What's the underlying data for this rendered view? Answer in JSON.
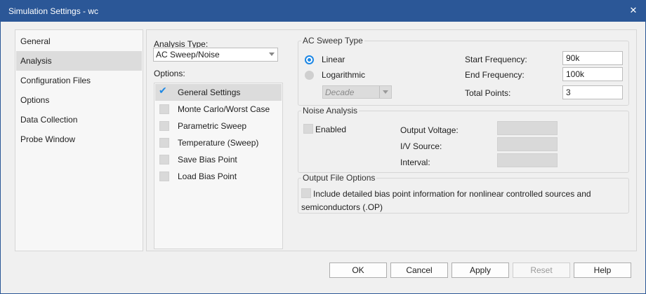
{
  "window": {
    "title": "Simulation Settings - wc",
    "close_glyph": "✕"
  },
  "sidebar": {
    "items": [
      {
        "label": "General"
      },
      {
        "label": "Analysis"
      },
      {
        "label": "Configuration Files"
      },
      {
        "label": "Options"
      },
      {
        "label": "Data Collection"
      },
      {
        "label": "Probe Window"
      }
    ],
    "selected": "Analysis"
  },
  "analysis": {
    "type_label": "Analysis Type:",
    "type_value": "AC Sweep/Noise",
    "options_label": "Options:",
    "options": [
      {
        "label": "General Settings",
        "checked": true
      },
      {
        "label": "Monte Carlo/Worst Case",
        "checked": false
      },
      {
        "label": "Parametric Sweep",
        "checked": false
      },
      {
        "label": "Temperature (Sweep)",
        "checked": false
      },
      {
        "label": "Save Bias Point",
        "checked": false
      },
      {
        "label": "Load Bias Point",
        "checked": false
      }
    ]
  },
  "ac_sweep": {
    "title": "AC Sweep Type",
    "linear_label": "Linear",
    "log_label": "Logarithmic",
    "selected": "Linear",
    "log_unit": "Decade",
    "start_label": "Start Frequency:",
    "start_value": "90k",
    "end_label": "End Frequency:",
    "end_value": "100k",
    "points_label": "Total Points:",
    "points_value": "3"
  },
  "noise": {
    "title": "Noise Analysis",
    "enabled_label": "Enabled",
    "enabled": false,
    "output_voltage_label": "Output Voltage:",
    "iv_source_label": "I/V Source:",
    "interval_label": "Interval:"
  },
  "output_file": {
    "title": "Output File Options",
    "bias_line1": "Include detailed bias point information for nonlinear controlled sources and",
    "bias_line2": "semiconductors (.OP)",
    "checked": false
  },
  "buttons": {
    "ok": "OK",
    "cancel": "Cancel",
    "apply": "Apply",
    "reset": "Reset",
    "help": "Help"
  },
  "colors": {
    "titlebar": "#2b5797",
    "accent": "#1e88e5",
    "selection": "#dcdcdc"
  }
}
